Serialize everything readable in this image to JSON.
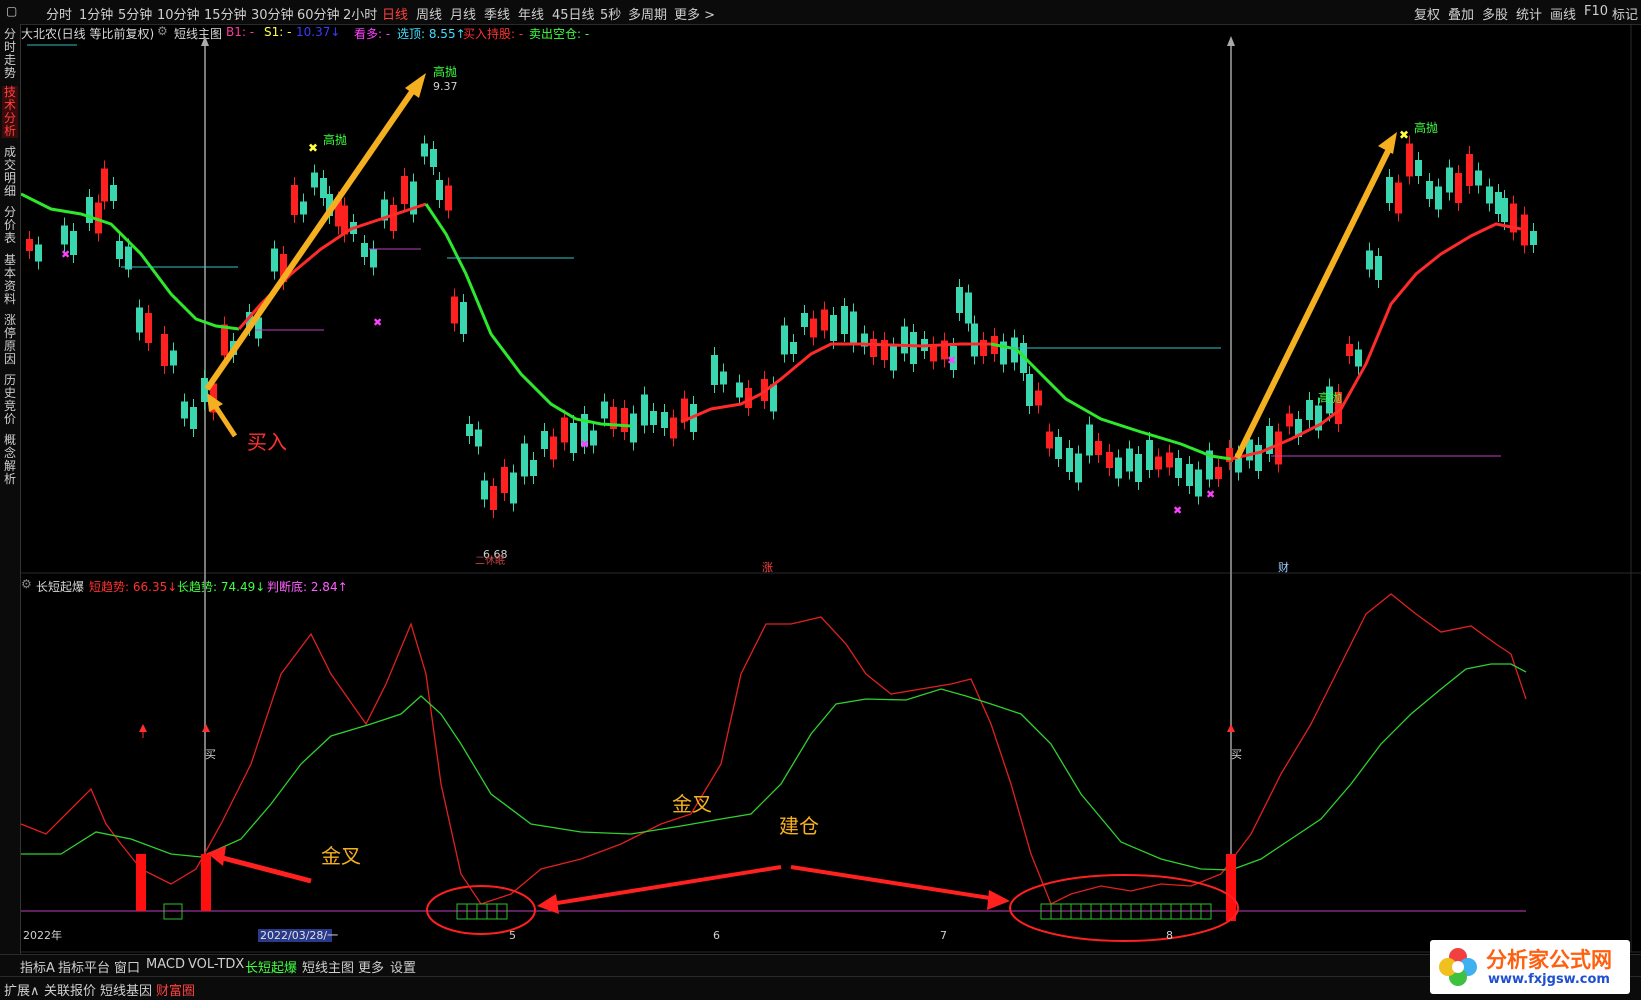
{
  "topbar": {
    "periods": [
      "分时",
      "1分钟",
      "5分钟",
      "10分钟",
      "15分钟",
      "30分钟",
      "60分钟",
      "2小时",
      "日线",
      "周线",
      "月线",
      "季线",
      "年线",
      "45日线",
      "5秒",
      "多周期",
      "更多 >"
    ],
    "selected": "日线",
    "right": [
      "复权",
      "叠加",
      "多股",
      "统计",
      "画线",
      "F10",
      "标记"
    ]
  },
  "sidebar": [
    "分时走势",
    "技术分析",
    "成交明细",
    "分价表",
    "基本资料",
    "涨停原因",
    "历史竞价",
    "概念解析"
  ],
  "main_info": {
    "stock": "大北农(日线 等比前复权)",
    "indicator": "短线主图",
    "b1": "B1: -",
    "s1": "S1: -",
    "s1_val": "10.37↓",
    "kanduo": "看多: -",
    "xuanding": "选顶: 8.55↑",
    "buy": "买入持股: -",
    "sell": "卖出空仓: -"
  },
  "sub_info": {
    "name": "长短起爆",
    "short": "短趋势: 66.35↓",
    "long": "长趋势: 74.49↓",
    "bottom": "判断底: 2.84↑"
  },
  "chart_labels": {
    "high1": "高抛",
    "price_high": "9.37",
    "high2": "高抛",
    "high3": "高抛",
    "price_low": "6.68",
    "low_tag": "二休眠",
    "zhang": "涨",
    "cai": "财",
    "buy1": "买",
    "buy2": "买"
  },
  "annotations": {
    "buyin": "买入",
    "goldcross1": "金叉",
    "goldcross2": "金叉",
    "build": "建仓"
  },
  "axis": {
    "year": "2022年",
    "date_sel": "2022/03/28/一",
    "months": [
      "5",
      "6",
      "7",
      "8"
    ]
  },
  "bottom_tabs": [
    "指标A",
    "指标平台",
    "窗口",
    "MACD",
    "VOL-TDX",
    "长短起爆",
    "短线主图",
    "更多",
    "设置"
  ],
  "bottom_tab_selected": "长短起爆",
  "bottom_row2": [
    "扩展∧",
    "关联报价",
    "短线基因",
    "财富圈"
  ],
  "logo": {
    "title": "分析家公式网",
    "url": "www.fxjgsw.com"
  },
  "colors": {
    "up": "#ff2020",
    "down": "#3ad6b0",
    "green_line": "#2ee82e",
    "red_line": "#ff2a2a",
    "arrow": "#f5b021"
  }
}
